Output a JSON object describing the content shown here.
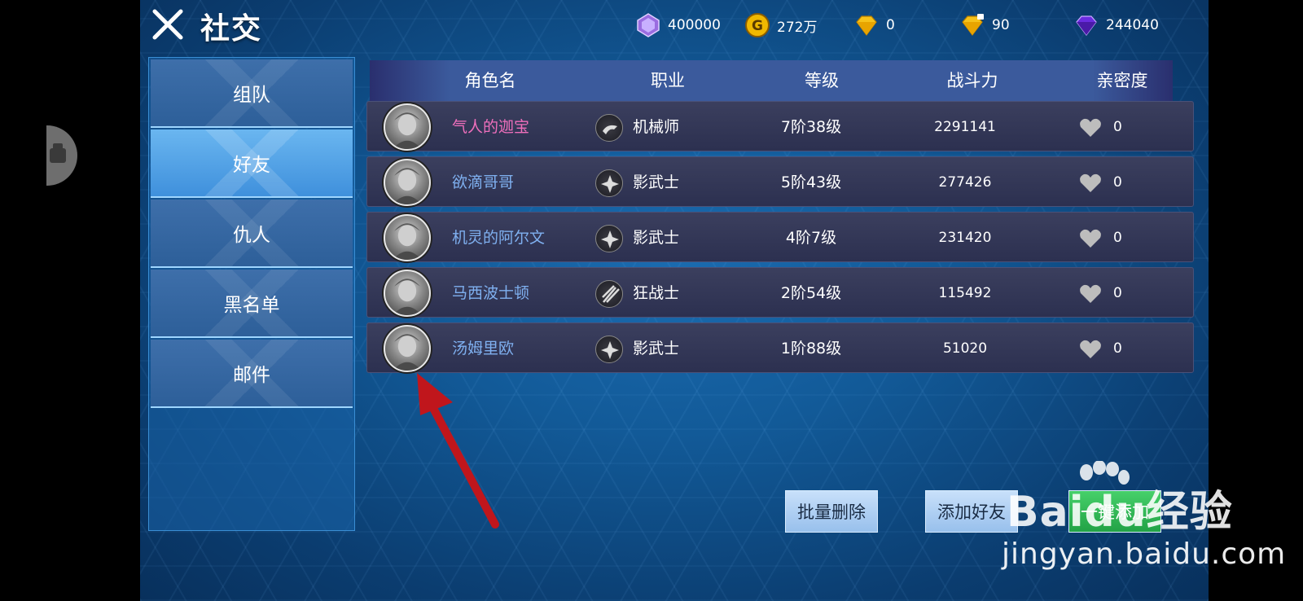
{
  "header": {
    "title": "社交",
    "close_icon": "close-icon"
  },
  "currencies": [
    {
      "icon": "purple-crystal-icon",
      "value": "400000"
    },
    {
      "icon": "gold-coin-icon",
      "value": "272万"
    },
    {
      "icon": "gold-diamond-icon",
      "value": "0"
    },
    {
      "icon": "bound-gold-diamond-icon",
      "value": "90"
    },
    {
      "icon": "purple-diamond-icon",
      "value": "244040"
    }
  ],
  "sidebar": {
    "items": [
      {
        "label": "组队",
        "active": false
      },
      {
        "label": "好友",
        "active": true
      },
      {
        "label": "仇人",
        "active": false
      },
      {
        "label": "黑名单",
        "active": false
      },
      {
        "label": "邮件",
        "active": false
      }
    ]
  },
  "table": {
    "headers": [
      "角色名",
      "职业",
      "等级",
      "战斗力",
      "亲密度"
    ],
    "rows": [
      {
        "name": "气人的迦宝",
        "name_color": "#ef6fbc",
        "job": "机械师",
        "level": "7阶38级",
        "power": "2291141",
        "intimacy": "0"
      },
      {
        "name": "欲滴哥哥",
        "name_color": "#7fb0f0",
        "job": "影武士",
        "level": "5阶43级",
        "power": "277426",
        "intimacy": "0"
      },
      {
        "name": "机灵的阿尔文",
        "name_color": "#7fb0f0",
        "job": "影武士",
        "level": "4阶7级",
        "power": "231420",
        "intimacy": "0"
      },
      {
        "name": "马西波士顿",
        "name_color": "#7fb0f0",
        "job": "狂战士",
        "level": "2阶54级",
        "power": "115492",
        "intimacy": "0"
      },
      {
        "name": "汤姆里欧",
        "name_color": "#7fb0f0",
        "job": "影武士",
        "level": "1阶88级",
        "power": "51020",
        "intimacy": "0"
      }
    ]
  },
  "buttons": {
    "batch_delete": "批量删除",
    "add_friend": "添加好友",
    "one_click_add": "一键添加"
  },
  "watermark": {
    "logo": "Baidu经验",
    "url": "jingyan.baidu.com"
  },
  "colors": {
    "accent_blue": "#3f90dc",
    "name_pink": "#ef6fbc",
    "name_blue": "#7fb0f0",
    "arrow_red": "#c0161c"
  }
}
